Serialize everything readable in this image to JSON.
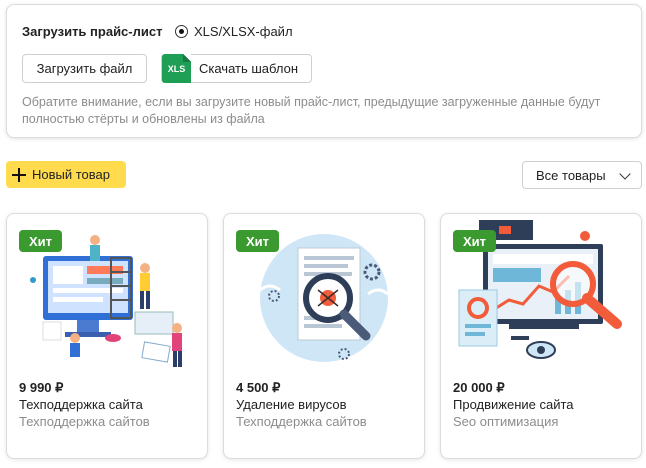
{
  "upload": {
    "title": "Загрузить прайс-лист",
    "format_option": "XLS/XLSX-файл",
    "upload_button": "Загрузить файл",
    "template_icon": "XLS",
    "template_button": "Скачать шаблон",
    "note": "Обратите внимание, если вы загрузите новый прайс-лист, предыдущие загруженные данные будут полностью стёрты и обновлены из файла"
  },
  "toolbar": {
    "new_product": "Новый товар",
    "filter_value": "Все товары"
  },
  "colors": {
    "accent": "#ffdb4d",
    "badge": "#3b9a2f",
    "xls": "#1f9e55"
  },
  "products": [
    {
      "badge": "Хит",
      "price": "9 990 ₽",
      "name": "Техподдержка сайта",
      "category": "Техподдержка сайтов",
      "illustration": "team-support-illustration"
    },
    {
      "badge": "Хит",
      "price": "4 500 ₽",
      "name": "Удаление вирусов",
      "category": "Техподдержка сайтов",
      "illustration": "virus-scan-illustration"
    },
    {
      "badge": "Хит",
      "price": "20 000 ₽",
      "name": "Продвижение сайта",
      "category": "Seo оптимизация",
      "illustration": "seo-analytics-illustration"
    }
  ]
}
